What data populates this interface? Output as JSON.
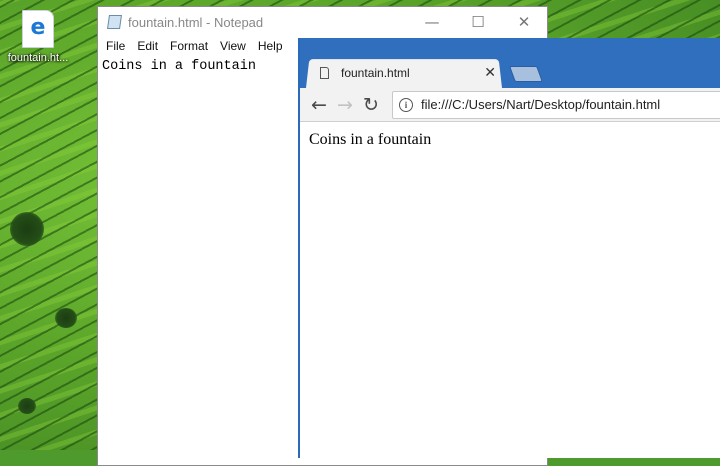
{
  "desktop": {
    "icon_label": "fountain.ht..."
  },
  "notepad": {
    "title": "fountain.html - Notepad",
    "controls": {
      "minimize": "—",
      "maximize": "☐",
      "close": "✕"
    },
    "menu": [
      "File",
      "Edit",
      "Format",
      "View",
      "Help"
    ],
    "content": "Coins in a fountain"
  },
  "browser": {
    "tab_title": "fountain.html",
    "tab_close": "✕",
    "address": "file:///C:/Users/Nart/Desktop/fountain.html",
    "page_text": "Coins in a fountain",
    "icons": {
      "back": "arrow-left-icon",
      "forward": "arrow-right-icon",
      "reload": "reload-icon",
      "info": "info-icon"
    },
    "accent_color": "#2f6fbe"
  }
}
